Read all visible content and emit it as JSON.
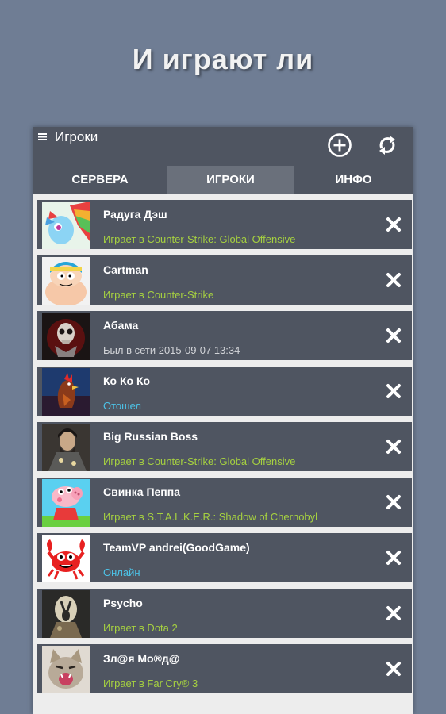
{
  "headline": "И играют ли",
  "app": {
    "title": "Игроки",
    "menu_icon": "list-icon",
    "add_icon": "add-circle-icon",
    "refresh_icon": "refresh-icon"
  },
  "tabs": [
    {
      "label": "СЕРВЕРА",
      "active": false
    },
    {
      "label": "ИГРОКИ",
      "active": true
    },
    {
      "label": "ИНФО",
      "active": false
    }
  ],
  "colors": {
    "playing": "#a6d140",
    "offline": "#d2d4d8",
    "away": "#4cc3e8",
    "online": "#4cc3e8",
    "row_bg": "#4f5561",
    "appbar_bg": "#4f5561",
    "page_bg": "#6f7d94"
  },
  "players": [
    {
      "name": "Радуга Дэш",
      "status": "Играет в Counter-Strike: Global Offensive",
      "state": "playing",
      "avatar": "rainbow-dash-avatar"
    },
    {
      "name": "Cartman",
      "status": "Играет в Counter-Strike",
      "state": "playing",
      "avatar": "cartman-avatar"
    },
    {
      "name": "Абама",
      "status": "Был в сети 2015-09-07 13:34",
      "state": "offline",
      "avatar": "skull-avatar"
    },
    {
      "name": "Ко Ко Ко",
      "status": "Отошел",
      "state": "away",
      "avatar": "rooster-avatar"
    },
    {
      "name": "Big Russian Boss",
      "status": "Играет в Counter-Strike: Global Offensive",
      "state": "playing",
      "avatar": "big-russian-boss-avatar"
    },
    {
      "name": "Свинка Пеппа",
      "status": "Играет в S.T.A.L.K.E.R.: Shadow of Chernobyl",
      "state": "playing",
      "avatar": "peppa-pig-avatar"
    },
    {
      "name": "TeamVP andrei(GoodGame)",
      "status": "Онлайн",
      "state": "online",
      "avatar": "crab-avatar"
    },
    {
      "name": "Psycho",
      "status": "Играет в Dota 2",
      "state": "playing",
      "avatar": "psycho-mask-avatar"
    },
    {
      "name": "Зл@я Мо®д@",
      "status": "Играет в Far Cry® 3",
      "state": "playing",
      "avatar": "cat-avatar"
    }
  ]
}
